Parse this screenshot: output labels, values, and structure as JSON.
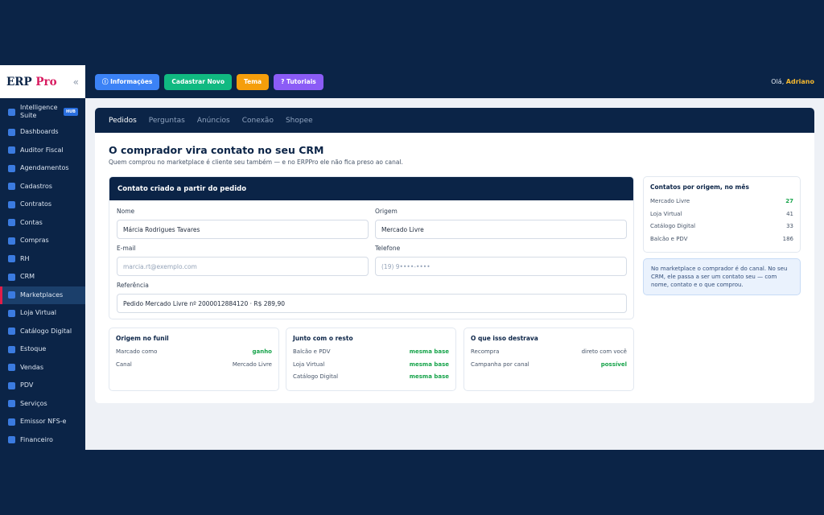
{
  "brand": {
    "name": "ERP",
    "accent": "Pro",
    "collapse": "«"
  },
  "sidebar": {
    "items": [
      {
        "label": "Intelligence Suite",
        "badge": "HUB"
      },
      {
        "label": "Dashboards"
      },
      {
        "label": "Auditor Fiscal"
      },
      {
        "label": "Agendamentos"
      },
      {
        "label": "Cadastros"
      },
      {
        "label": "Contratos"
      },
      {
        "label": "Contas"
      },
      {
        "label": "Compras"
      },
      {
        "label": "RH"
      },
      {
        "label": "CRM"
      },
      {
        "label": "Marketplaces",
        "active": true
      },
      {
        "label": "Loja Virtual"
      },
      {
        "label": "Catálogo Digital"
      },
      {
        "label": "Estoque"
      },
      {
        "label": "Vendas"
      },
      {
        "label": "PDV"
      },
      {
        "label": "Serviços"
      },
      {
        "label": "Emissor NFS-e"
      },
      {
        "label": "Financeiro"
      }
    ]
  },
  "topbar": {
    "info_label": "ⓘ Informações",
    "new_label": "Cadastrar Novo",
    "theme_label": "Tema",
    "tutorials_label": "? Tutoriais",
    "greeting": "Olá, ",
    "user": "Adriano"
  },
  "tabs": [
    "Pedidos",
    "Perguntas",
    "Anúncios",
    "Conexão",
    "Shopee"
  ],
  "main": {
    "title": "O comprador vira contato no seu CRM",
    "subtitle": "Quem comprou no marketplace é cliente seu também — e no ERPPro ele não fica preso ao canal."
  },
  "form": {
    "title": "Contato criado a partir do pedido",
    "name_label": "Nome",
    "name_value": "Márcia Rodrigues Tavares",
    "origin_label": "Origem",
    "origin_value": "Mercado Livre",
    "email_label": "E-mail",
    "email_placeholder": "marcia.rt@exemplo.com",
    "phone_label": "Telefone",
    "phone_placeholder": "(19) 9••••-••••",
    "ref_label": "Referência",
    "ref_value": "Pedido Mercado Livre nº 2000012884120 · R$ 289,90"
  },
  "cards": [
    {
      "title": "Origem no funil",
      "rows": [
        {
          "k": "Marcado como",
          "v": "ganho",
          "green": true
        },
        {
          "k": "Canal",
          "v": "Mercado Livre"
        }
      ]
    },
    {
      "title": "Junto com o resto",
      "rows": [
        {
          "k": "Balcão e PDV",
          "v": "mesma base",
          "green": true
        },
        {
          "k": "Loja Virtual",
          "v": "mesma base",
          "green": true
        },
        {
          "k": "Catálogo Digital",
          "v": "mesma base",
          "green": true
        }
      ]
    },
    {
      "title": "O que isso destrava",
      "rows": [
        {
          "k": "Recompra",
          "v": "direto com você"
        },
        {
          "k": "Campanha por canal",
          "v": "possível",
          "green": true
        }
      ]
    }
  ],
  "contacts": {
    "title": "Contatos por origem, no mês",
    "rows": [
      {
        "k": "Mercado Livre",
        "v": "27",
        "green": true
      },
      {
        "k": "Loja Virtual",
        "v": "41"
      },
      {
        "k": "Catálogo Digital",
        "v": "33"
      },
      {
        "k": "Balcão e PDV",
        "v": "186"
      }
    ]
  },
  "note": "No marketplace o comprador é do canal. No seu CRM, ele passa a ser um contato seu — com nome, contato e o que comprou.",
  "colors": {
    "navy": "#0b2447",
    "green": "#16a34a",
    "accent_pink": "#d81b60"
  }
}
